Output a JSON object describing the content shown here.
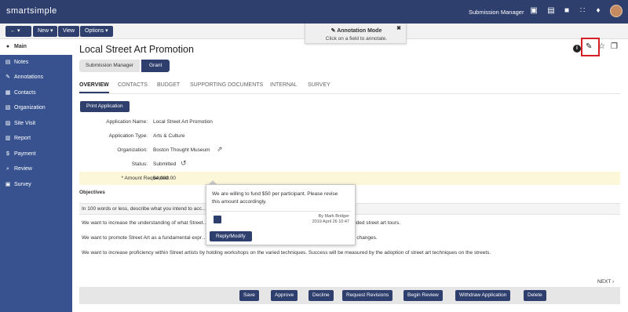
{
  "top_nav": {
    "logo": "smartsimple",
    "submission_manager": "Submission Manager",
    "icons": [
      "translate-icon",
      "document-icon",
      "lock-icon",
      "grid-icon",
      "bell-icon",
      "avatar"
    ]
  },
  "subbar": {
    "back_label": "← ▾",
    "new_label": "New ▾",
    "view_label": "View",
    "options_label": "Options ▾"
  },
  "annotation": {
    "title": "✎ Annotation Mode",
    "subtitle": "Click on a field to annotate.",
    "close": "✖"
  },
  "sidebar": {
    "items": [
      {
        "label": "Main",
        "icon": "●"
      },
      {
        "label": "Notes",
        "icon": "▤"
      },
      {
        "label": "Annotations",
        "icon": "✎"
      },
      {
        "label": "Contacts",
        "icon": "▦"
      },
      {
        "label": "Organization",
        "icon": "▧"
      },
      {
        "label": "Site Visit",
        "icon": "▨"
      },
      {
        "label": "Report",
        "icon": "▥"
      },
      {
        "label": "Payment",
        "icon": "$"
      },
      {
        "label": "Review",
        "icon": "⌕"
      },
      {
        "label": "Survey",
        "icon": "▣"
      }
    ]
  },
  "page": {
    "title": "Local Street Art Promotion",
    "breadcrumb": [
      "Submission Manager",
      "Grant"
    ]
  },
  "tabs": [
    "OVERVIEW",
    "CONTACTS",
    "BUDGET",
    "SUPPORTING DOCUMENTS",
    "INTERNAL",
    "SURVEY"
  ],
  "print_button": "Print Application",
  "fields": [
    {
      "label": "Application Name:",
      "value": "Local Street Art Promotion"
    },
    {
      "label": "Application Type:",
      "value": "Arts & Culture"
    },
    {
      "label": "Organization:",
      "value": "Boston Thought Museum"
    },
    {
      "label": "Status:",
      "value": "Submitted"
    },
    {
      "label": "* Amount Requested:",
      "value": "$4,000.00"
    }
  ],
  "objectives": {
    "title": "Objectives",
    "question": "In 100 words or less, describe what you intend to acc… towards these objectives.",
    "lines": [
      "We want to increase the understanding of what Street… ess will be measured by the number of people that attend our guided street art tours.",
      "We want to promote Street Art as a fundamental expr… number of places street art exists in our city and how frequently it changes.",
      "We want to increase proficiency within Street artists by holding workshops on the varied techniques. Success will be measured by the adoption of street art techniques on the streets."
    ]
  },
  "tooltip": {
    "line1": "We are willing to fund $50 per participant. Please revise",
    "line2": "this amount accordingly.",
    "author": "By Mark Bridger",
    "date": "2019 April 26 10:47",
    "reply_button": "Reply/Modify"
  },
  "next_label": "NEXT ›",
  "footer_buttons": [
    "Save",
    "Approve",
    "Decline",
    "Request Revisions",
    "Begin Review",
    "Withdraw Application",
    "Delete"
  ],
  "colors": {
    "navy": "#2e3f6e",
    "sidebar_blue": "#37528f",
    "highlight": "#fdf7d9",
    "red": "#d61f26"
  }
}
